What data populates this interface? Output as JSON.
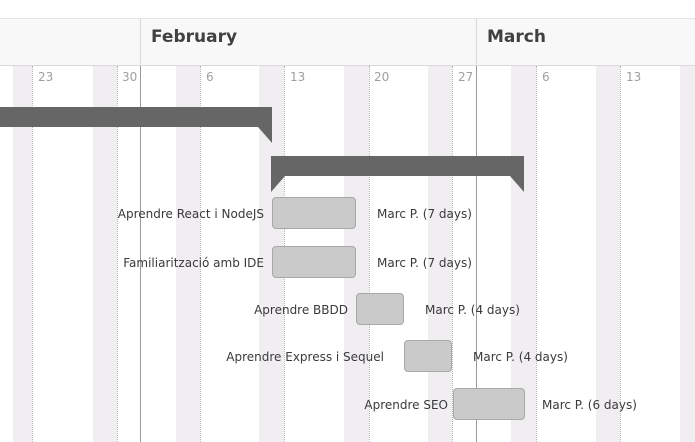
{
  "timeline": {
    "months": [
      {
        "id": "february",
        "label": "February"
      },
      {
        "id": "march",
        "label": "March"
      }
    ],
    "week_ticks": [
      "23",
      "30",
      "6",
      "13",
      "20",
      "27",
      "6",
      "13"
    ]
  },
  "tasks": [
    {
      "id": "react-nodejs",
      "name": "Aprendre React i NodeJS",
      "resource": "Marc P. (7 days)"
    },
    {
      "id": "ide",
      "name": "Familiarització amb IDE",
      "resource": "Marc P. (7 days)"
    },
    {
      "id": "bbdd",
      "name": "Aprendre BBDD",
      "resource": "Marc P. (4 days)"
    },
    {
      "id": "express-sequel",
      "name": "Aprendre Express i Sequel",
      "resource": "Marc P. (4 days)"
    },
    {
      "id": "seo",
      "name": "Aprendre SEO",
      "resource": "Marc P. (6 days)"
    }
  ],
  "colors": {
    "summary_bar": "#666666",
    "task_bar": "#cacaca",
    "weekend_shade": "#f1eef2",
    "header_background": "#f8f8f8"
  }
}
